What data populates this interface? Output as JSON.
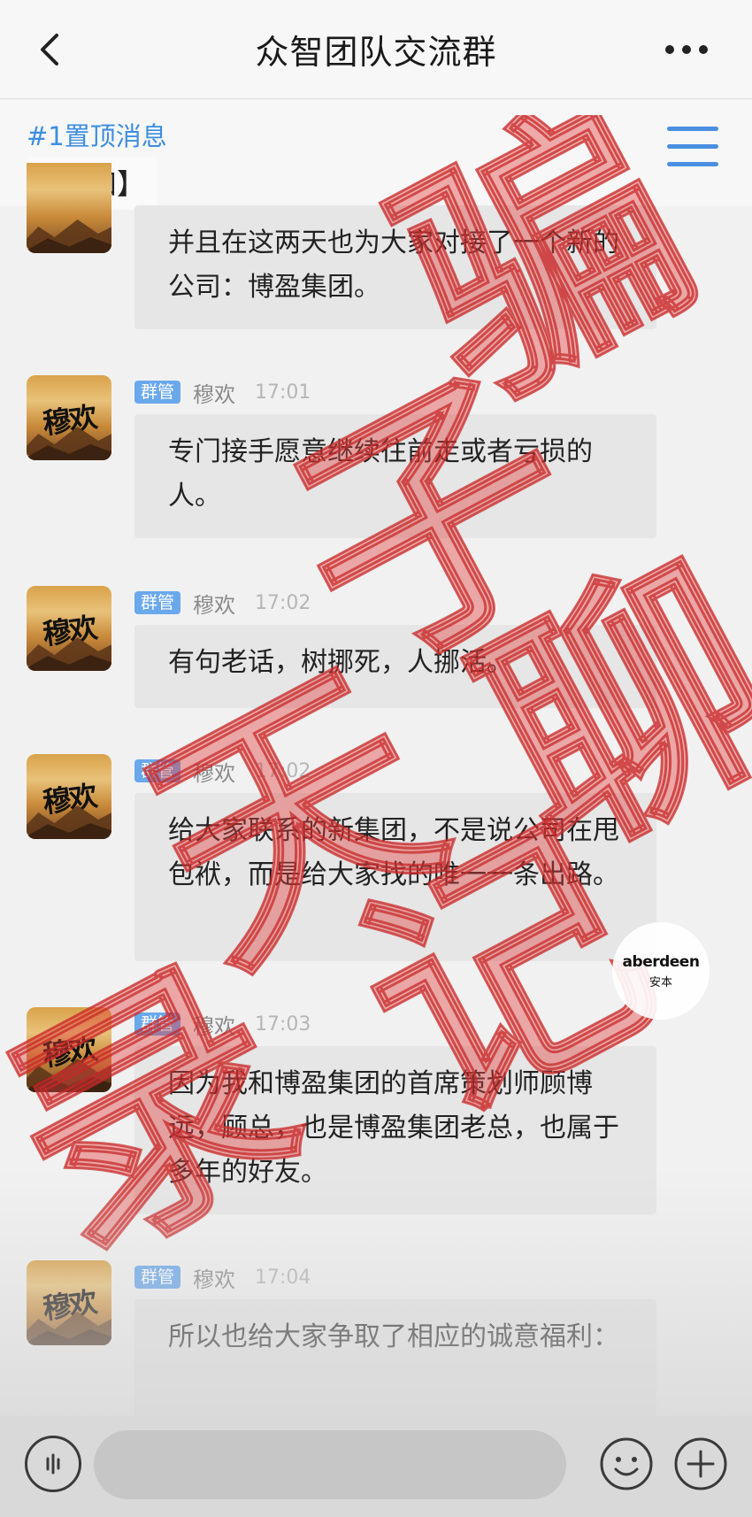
{
  "header": {
    "title": "众智团队交流群"
  },
  "pinned": {
    "tag": "#1置顶消息",
    "text": "【通知】"
  },
  "messages": [
    {
      "badge": "",
      "sender": "",
      "time": "",
      "text": "并且在这两天也为大家对接了一个新的公司：博盈集团。"
    },
    {
      "badge": "群管",
      "sender": "穆欢",
      "time": "17:01",
      "text": "专门接手愿意继续往前走或者亏损的人。"
    },
    {
      "badge": "群管",
      "sender": "穆欢",
      "time": "17:02",
      "text": "有句老话，树挪死，人挪活。"
    },
    {
      "badge": "群管",
      "sender": "穆欢",
      "time": "17:02",
      "text": "给大家联系的新集团，不是说公司在甩包袱，而是给大家找的唯一一条出路。"
    },
    {
      "badge": "群管",
      "sender": "穆欢",
      "time": "17:03",
      "text": "因为我和博盈集团的首席策划师顾博远，顾总，也是博盈集团老总，也属于多年的好友。"
    },
    {
      "badge": "群管",
      "sender": "穆欢",
      "time": "17:04",
      "text": "所以也给大家争取了相应的诚意福利："
    }
  ],
  "avatar": {
    "label": "穆欢"
  },
  "watermark": {
    "text": "原骗子聊天记录",
    "chars": [
      "骗",
      "子",
      "聊",
      "天",
      "记",
      "录"
    ]
  },
  "badge_logo": {
    "en": "aberdeen",
    "cn": "安本"
  },
  "colors": {
    "accent": "#3e8ee0",
    "badge": "#6aa8ec",
    "watermark": "#e0413f"
  },
  "icons": {
    "back": "chevron-left-icon",
    "more": "more-icon",
    "menu": "menu-icon",
    "voice": "voice-icon",
    "emoji": "emoji-icon",
    "add": "plus-icon"
  }
}
